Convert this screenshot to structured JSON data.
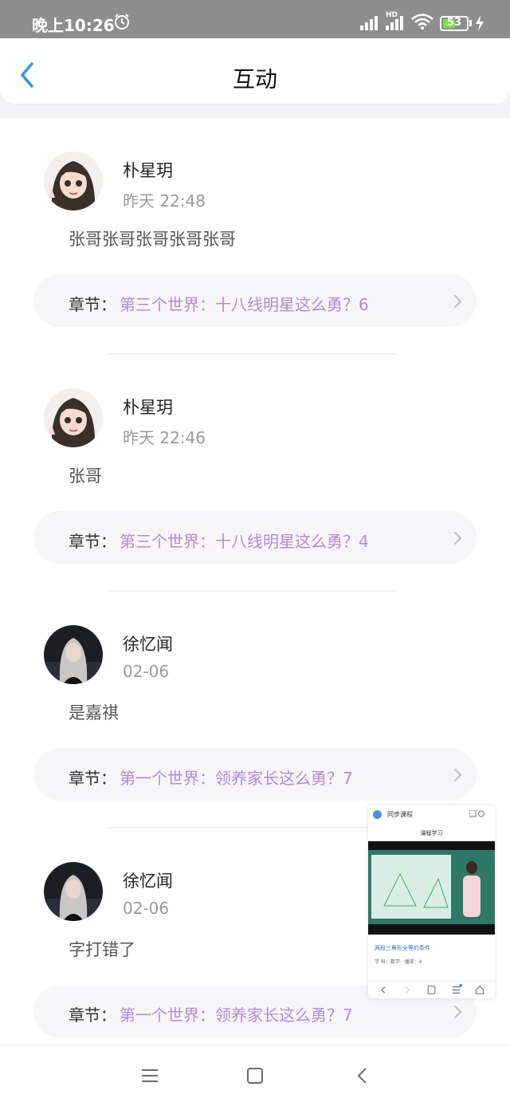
{
  "status_bar": {
    "time": "晚上10:26",
    "network_label": "HD",
    "battery_level": "53",
    "battery_fraction": 0.53
  },
  "header": {
    "title": "互动",
    "back_icon": "chevron-left-icon",
    "accent_color": "#3a8fe8"
  },
  "chapter_color": "#b48ad6",
  "items": [
    {
      "user": "朴星玥",
      "time": "昨天 22:48",
      "comment": "张哥张哥张哥张哥张哥",
      "chapter_label": "章节：",
      "chapter_title": "第三个世界：十八线明星这么勇？6"
    },
    {
      "user": "朴星玥",
      "time": "昨天 22:46",
      "comment": "张哥",
      "chapter_label": "章节：",
      "chapter_title": "第三个世界：十八线明星这么勇？4"
    },
    {
      "user": "徐忆闻",
      "time": "02-06",
      "comment": "是嘉祺",
      "chapter_label": "章节：",
      "chapter_title": "第一个世界：领养家长这么勇？7"
    },
    {
      "user": "徐忆闻",
      "time": "02-06",
      "comment": "字打错了",
      "chapter_label": "章节：",
      "chapter_title": "第一个世界：领养家长这么勇？7"
    }
  ],
  "floating_window": {
    "top_title": "同步课程",
    "nav_title": "课程学习",
    "course_title": "两段三角形全等的条件",
    "meta": "学 科：数学 · 播放：4"
  },
  "nav_bar": {
    "icons": [
      "menu-icon",
      "home-square-icon",
      "back-triangle-icon"
    ]
  }
}
